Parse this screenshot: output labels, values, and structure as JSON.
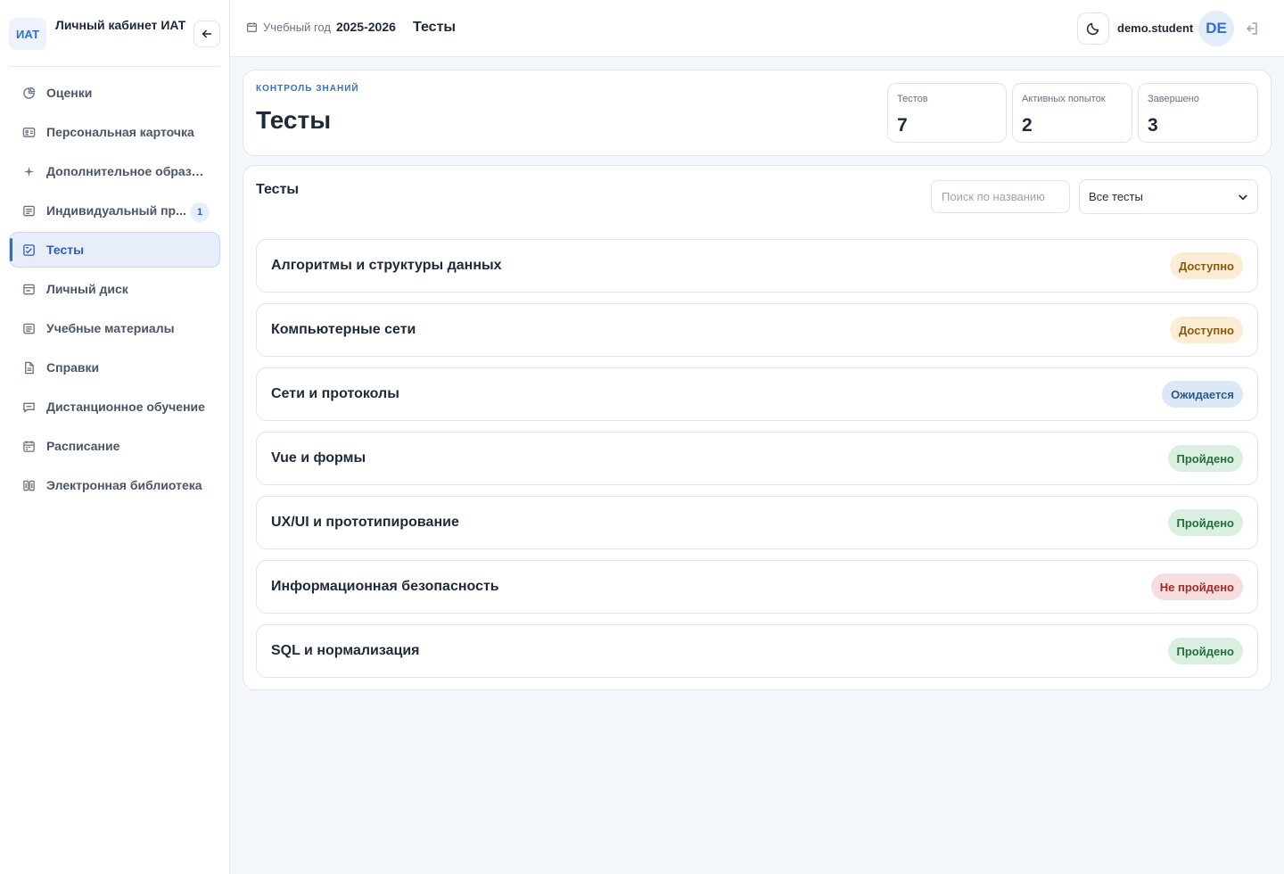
{
  "brand": {
    "logo": "ИАТ",
    "title": "Личный кабинет ИАТ"
  },
  "sidebar": {
    "items": [
      {
        "label": "Оценки",
        "icon": "pie-chart-icon"
      },
      {
        "label": "Персональная карточка",
        "icon": "id-card-icon"
      },
      {
        "label": "Дополнительное образов...",
        "icon": "sparkle-icon"
      },
      {
        "label": "Индивидуальный пр...",
        "icon": "document-icon",
        "badge": "1"
      },
      {
        "label": "Тесты",
        "icon": "test-icon",
        "active": true
      },
      {
        "label": "Личный диск",
        "icon": "disk-icon"
      },
      {
        "label": "Учебные материалы",
        "icon": "book-icon"
      },
      {
        "label": "Справки",
        "icon": "file-icon"
      },
      {
        "label": "Дистанционное обучение",
        "icon": "chat-icon"
      },
      {
        "label": "Расписание",
        "icon": "calendar-icon"
      },
      {
        "label": "Электронная библиотека",
        "icon": "library-icon"
      }
    ]
  },
  "topbar": {
    "year_label": "Учебный год",
    "year_value": "2025-2026",
    "title": "Тесты",
    "username": "demo.student",
    "avatar": "DE"
  },
  "header": {
    "eyebrow": "контроль знаний",
    "title": "Тесты",
    "stats": [
      {
        "label": "Тестов",
        "value": "7"
      },
      {
        "label": "Активных попыток",
        "value": "2"
      },
      {
        "label": "Завершено",
        "value": "3"
      }
    ]
  },
  "list": {
    "title": "Тесты",
    "search_placeholder": "Поиск по названию",
    "filter_value": "Все тесты",
    "tests": [
      {
        "name": "Алгоритмы и структуры данных",
        "status": "Доступно",
        "status_type": "available"
      },
      {
        "name": "Компьютерные сети",
        "status": "Доступно",
        "status_type": "available"
      },
      {
        "name": "Сети и протоколы",
        "status": "Ожидается",
        "status_type": "pending"
      },
      {
        "name": "Vue и формы",
        "status": "Пройдено",
        "status_type": "passed"
      },
      {
        "name": "UX/UI и прототипирование",
        "status": "Пройдено",
        "status_type": "passed"
      },
      {
        "name": "Информационная безопасность",
        "status": "Не пройдено",
        "status_type": "failed"
      },
      {
        "name": "SQL и нормализация",
        "status": "Пройдено",
        "status_type": "passed"
      }
    ]
  },
  "colors": {
    "accent": "#2f6fd4",
    "available_bg": "#fbedd3",
    "available_fg": "#8a5a12",
    "pending_bg": "#dde8f5",
    "pending_fg": "#2c5a8c",
    "passed_bg": "#dbeee2",
    "passed_fg": "#23703f",
    "failed_bg": "#f6dede",
    "failed_fg": "#a12a2a"
  }
}
